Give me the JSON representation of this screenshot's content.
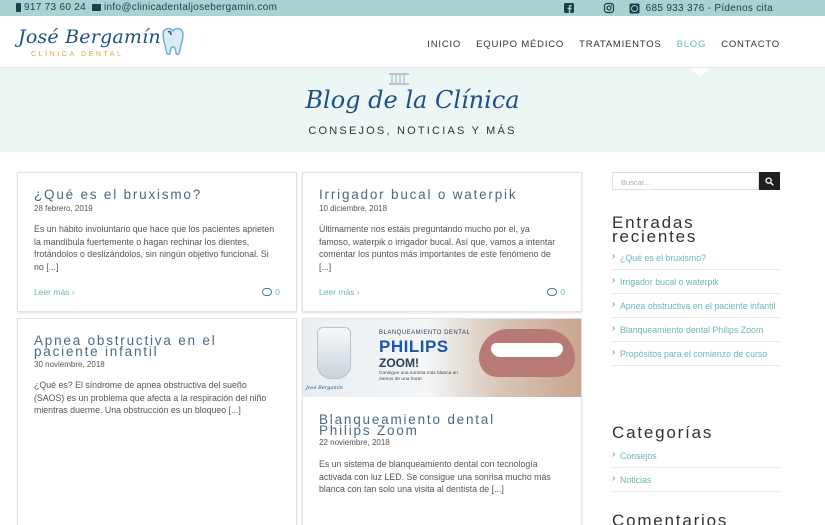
{
  "topbar": {
    "phone": "917 73 60 24",
    "email": "info@clinicadentaljosebergamin.com",
    "social": [
      "facebook-icon",
      "instagram-icon"
    ],
    "whatsapp": "685 933 376 - Pídenos cita"
  },
  "logo": {
    "name": "José Bergamín",
    "subtitle": "CLÍNICA DENTAL"
  },
  "nav": {
    "items": [
      "INICIO",
      "EQUIPO MÉDICO",
      "TRATAMIENTOS",
      "BLOG",
      "CONTACTO"
    ],
    "active": "BLOG"
  },
  "hero": {
    "title": "Blog de la Clínica",
    "subtitle": "CONSEJOS, NOTICIAS Y MÁS"
  },
  "posts": [
    {
      "title": "¿Qué es el bruxismo?",
      "date": "28 febrero, 2019",
      "excerpt": "Es un hábito involuntario que hace que los pacientes aprieten la mandíbula fuertemente o hagan rechinar los dientes, frotándolos o deslizándolos, sin ningún objetivo funcional. Si no [...]",
      "more": "Leer más ›",
      "comments": "0"
    },
    {
      "title": "Irrigador bucal o waterpik",
      "date": "10 diciembre, 2018",
      "excerpt": "Últimamente nos estáis preguntando mucho por el, ya famoso, waterpik o irrigador bucal. Así que, vamos a intentar comentar los puntos más importantes de este fenómeno de [...]",
      "more": "Leer más ›",
      "comments": "0"
    },
    {
      "title_line1": "Apnea obstructiva en el",
      "title_line2": "paciente infantil",
      "date": "30 noviembre, 2018",
      "excerpt": "¿Qué es? El síndrome de apnea obstructiva del sueño (SAOS) es un problema que afecta a la respiración del niño mientras duerme. Una obstrucción es un bloqueo [...]"
    },
    {
      "image": {
        "small": "BLANQUEAMIENTO DENTAL",
        "brand": "PHILIPS",
        "zoom": "ZOOM!",
        "caption": "Consigue una sonrisa más blanca en menos de una hora!",
        "logo": "José Bergamín"
      },
      "title_line1": "Blanqueamiento dental",
      "title_line2": "Philips Zoom",
      "date": "22 noviembre, 2018",
      "excerpt": "Es un sistema de blanqueamiento dental con tecnología activada con luz LED. Se consigue una sonrisa mucho más blanca con tan solo una visita al dentista de [...]"
    }
  ],
  "sidebar": {
    "search_placeholder": "Buscar...",
    "recent_title_line1": "Entradas",
    "recent_title_line2": "recientes",
    "recent": [
      "¿Qué es el bruxismo?",
      "Irrigador bucal o waterpik",
      "Apnea obstructiva en el paciente infantil",
      "Blanqueamiento dental Philips Zoom",
      "Propósitos para el comienzo de curso"
    ],
    "categories_title": "Categorías",
    "categories": [
      "Consejos",
      "Noticias"
    ],
    "comments_title": "Comentarios"
  },
  "colors": {
    "topbar": "#a8d3d2",
    "hero_bg": "#ecf6f5",
    "brand_blue": "#1e4f86",
    "accent_teal": "#6bb7b4",
    "title_blue": "#4a6a85"
  }
}
